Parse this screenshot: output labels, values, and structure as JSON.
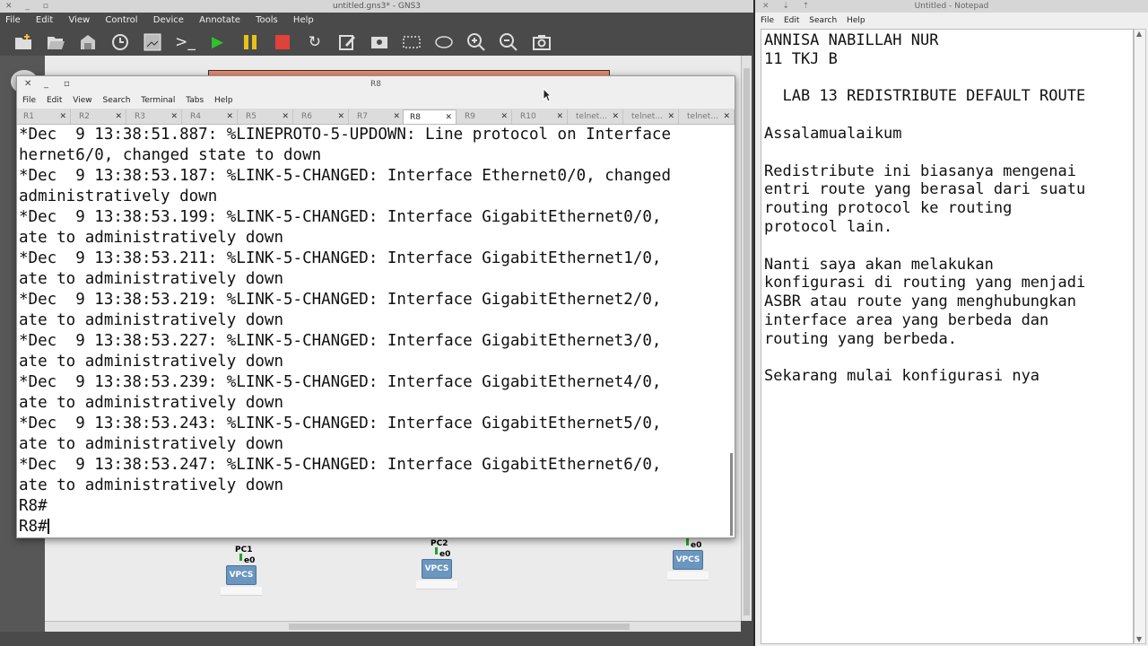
{
  "gns3": {
    "title": "untitled.gns3* - GNS3",
    "window_buttons": "✕ _ ▫",
    "menu": [
      "File",
      "Edit",
      "View",
      "Control",
      "Device",
      "Annotate",
      "Tools",
      "Help"
    ],
    "toolbar_icons": [
      "folder-new-icon",
      "folder-open-icon",
      "save-icon",
      "clock-icon",
      "screenshot-icon",
      "console-icon",
      "play-icon",
      "pause-icon",
      "stop-icon",
      "reload-icon",
      "edit-note-icon",
      "image-icon",
      "rectangle-icon",
      "ellipse-icon",
      "zoom-in-icon",
      "zoom-out-icon",
      "camera-icon"
    ],
    "nodes": [
      {
        "label": "PC1",
        "port": "e0",
        "type": "VPCS"
      },
      {
        "label": "PC2",
        "port": "e0",
        "type": "VPCS"
      },
      {
        "label": "",
        "port": "e0",
        "type": "VPCS"
      }
    ]
  },
  "terminal": {
    "title": "R8",
    "menu": [
      "File",
      "Edit",
      "View",
      "Search",
      "Terminal",
      "Tabs",
      "Help"
    ],
    "tabs": [
      "R1",
      "R2",
      "R3",
      "R4",
      "R5",
      "R6",
      "R7",
      "R8",
      "R9",
      "R10",
      "telnet...",
      "telnet...",
      "telnet..."
    ],
    "active_tab": "R8",
    "lines": [
      "*Dec  9 13:38:51.887: %LINEPROTO-5-UPDOWN: Line protocol on Interface",
      "hernet6/0, changed state to down",
      "*Dec  9 13:38:53.187: %LINK-5-CHANGED: Interface Ethernet0/0, changed",
      "administratively down",
      "*Dec  9 13:38:53.199: %LINK-5-CHANGED: Interface GigabitEthernet0/0,",
      "ate to administratively down",
      "*Dec  9 13:38:53.211: %LINK-5-CHANGED: Interface GigabitEthernet1/0,",
      "ate to administratively down",
      "*Dec  9 13:38:53.219: %LINK-5-CHANGED: Interface GigabitEthernet2/0,",
      "ate to administratively down",
      "*Dec  9 13:38:53.227: %LINK-5-CHANGED: Interface GigabitEthernet3/0,",
      "ate to administratively down",
      "*Dec  9 13:38:53.239: %LINK-5-CHANGED: Interface GigabitEthernet4/0,",
      "ate to administratively down",
      "*Dec  9 13:38:53.243: %LINK-5-CHANGED: Interface GigabitEthernet5/0,",
      "ate to administratively down",
      "*Dec  9 13:38:53.247: %LINK-5-CHANGED: Interface GigabitEthernet6/0,",
      "ate to administratively down",
      "R8#",
      "R8#"
    ]
  },
  "notepad": {
    "title": "Untitled - Notepad",
    "window_buttons": "✕ ⇣ ⇡",
    "menu": [
      "File",
      "Edit",
      "Search",
      "Help"
    ],
    "text": "ANNISA NABILLAH NUR\n11 TKJ B\n\n  LAB 13 REDISTRIBUTE DEFAULT ROUTE\n\nAssalamualaikum\n\nRedistribute ini biasanya mengenai\nentri route yang berasal dari suatu\nrouting protocol ke routing\nprotocol lain.\n\nNanti saya akan melakukan\nkonfigurasi di routing yang menjadi\nASBR atau route yang menghubungkan\ninterface area yang berbeda dan\nrouting yang berbeda.\n\nSekarang mulai konfigurasi nya"
  }
}
